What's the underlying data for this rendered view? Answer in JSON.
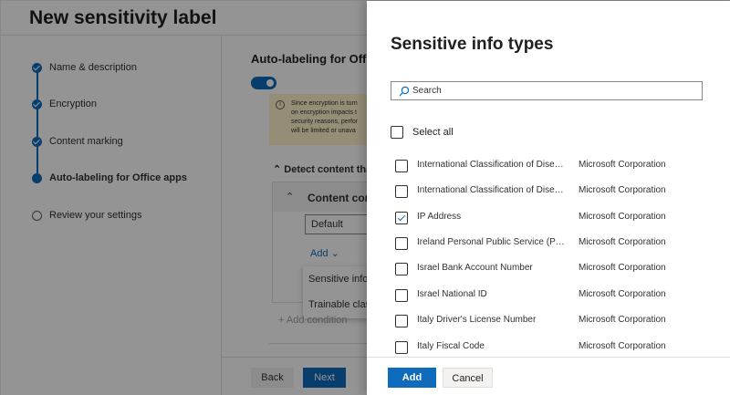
{
  "wizard": {
    "title": "New sensitivity label",
    "steps": [
      {
        "label": "Name & description",
        "state": "done"
      },
      {
        "label": "Encryption",
        "state": "done"
      },
      {
        "label": "Content marking",
        "state": "done"
      },
      {
        "label": "Auto-labeling for Office apps",
        "state": "current"
      },
      {
        "label": "Review your settings",
        "state": "todo"
      }
    ],
    "content_heading": "Auto-labeling for Offic",
    "warning_lines": [
      "Since encryption is turn",
      "on encryption impacts t",
      "security reasons, perfor",
      "will be limited or unava"
    ],
    "detect_label": "Detect content that",
    "panel_title": "Content conta",
    "select_value": "Default",
    "add_link": "Add",
    "menu_items": [
      "Sensitive info ty",
      "Trainable classif"
    ],
    "add_condition": "+ Add condition",
    "back_label": "Back",
    "next_label": "Next"
  },
  "flyout": {
    "title": "Sensitive info types",
    "search_placeholder": "Search",
    "select_all_label": "Select all",
    "rows": [
      {
        "name": "International Classification of Disease...",
        "publisher": "Microsoft Corporation",
        "checked": false
      },
      {
        "name": "International Classification of Disease...",
        "publisher": "Microsoft Corporation",
        "checked": false
      },
      {
        "name": "IP Address",
        "publisher": "Microsoft Corporation",
        "checked": true
      },
      {
        "name": "Ireland Personal Public Service (PPS) ...",
        "publisher": "Microsoft Corporation",
        "checked": false
      },
      {
        "name": "Israel Bank Account Number",
        "publisher": "Microsoft Corporation",
        "checked": false
      },
      {
        "name": "Israel National ID",
        "publisher": "Microsoft Corporation",
        "checked": false
      },
      {
        "name": "Italy Driver's License Number",
        "publisher": "Microsoft Corporation",
        "checked": false
      },
      {
        "name": "Italy Fiscal Code",
        "publisher": "Microsoft Corporation",
        "checked": false
      }
    ],
    "add_label": "Add",
    "cancel_label": "Cancel"
  },
  "colors": {
    "accent": "#0f6cbd",
    "warning_bg": "#fff4ce"
  }
}
